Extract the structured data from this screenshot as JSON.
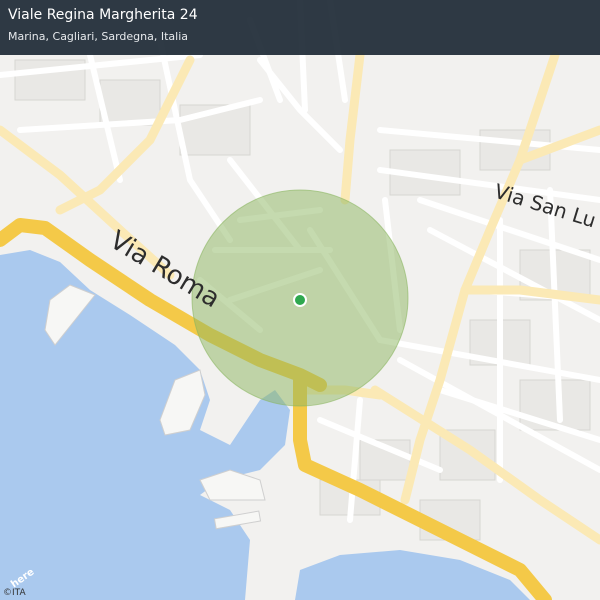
{
  "header": {
    "title": "Viale Regina Margherita 24",
    "subtitle": "Marina, Cagliari, Sardegna, Italia"
  },
  "streets": {
    "via_roma": "Via Roma",
    "via_san_lu": "Via San Lu"
  },
  "map": {
    "accuracy_circle_color": "#8bb560",
    "location_marker_color": "#2fa84f",
    "water_color": "#aac9ee",
    "major_road_color": "#f4c948",
    "secondary_road_color": "#fbe9b5"
  },
  "attribution": "©ITA",
  "logo": "here"
}
